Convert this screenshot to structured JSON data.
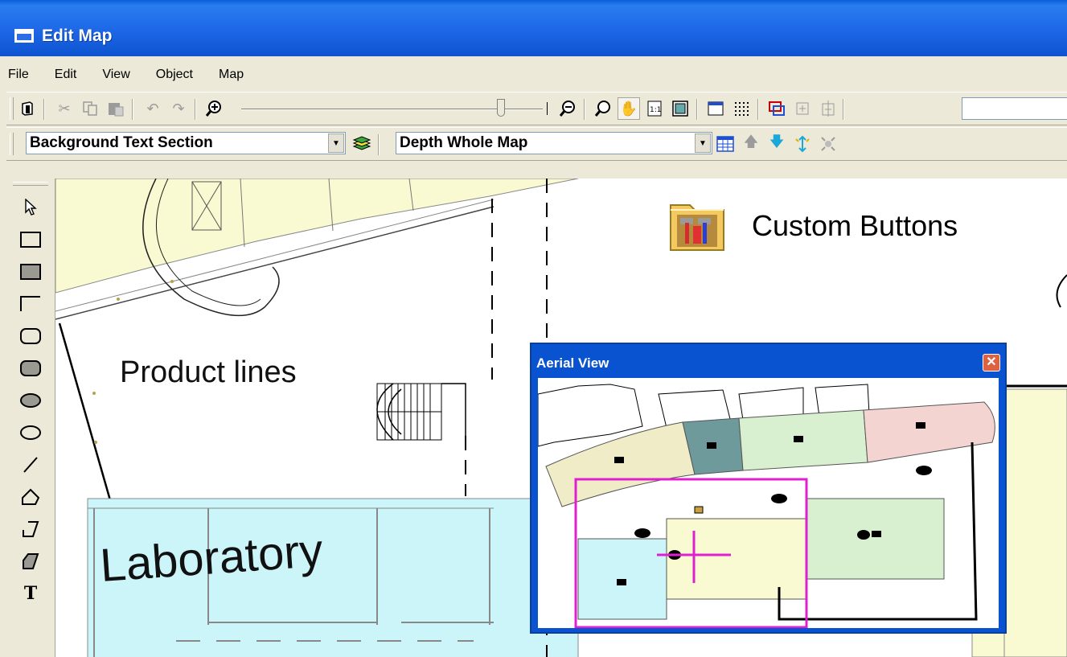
{
  "window": {
    "title": "Edit Map"
  },
  "menu": [
    "File",
    "Edit",
    "View",
    "Object",
    "Map"
  ],
  "toolbar2": {
    "section_select": "Background Text Section",
    "depth_select": "Depth Whole Map"
  },
  "map": {
    "labels": {
      "product_lines": "Product lines",
      "laboratory": "Laboratory",
      "custom_buttons": "Custom Buttons"
    }
  },
  "aerial_view": {
    "title": "Aerial View",
    "close_glyph": "✕"
  },
  "colors": {
    "titlebar": "#1d67e6",
    "aerial_frame": "#0a53d0",
    "zone_yellow": "#fafad2",
    "zone_cyan": "#ccf5fa",
    "zone_green": "#d8f0d0",
    "zone_pink": "#f4d4d0",
    "zone_teal": "#5a8a8c",
    "aerial_selection": "#e020d0"
  }
}
